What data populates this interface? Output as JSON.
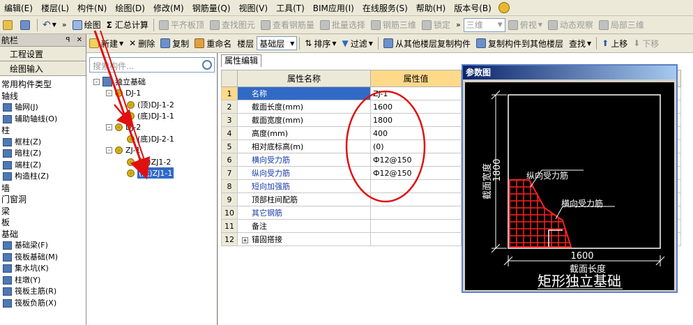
{
  "menubar": {
    "items": [
      "编辑(E)",
      "楼层(L)",
      "构件(N)",
      "绘图(D)",
      "修改(M)",
      "钢筋量(Q)",
      "视图(V)",
      "工具(T)",
      "BIM应用(I)",
      "在线服务(S)",
      "帮助(H)",
      "版本号(B)"
    ]
  },
  "toolbar1": {
    "draw": "绘图",
    "summary": "汇总计算",
    "flat_top": "平齐板顶",
    "find_element": "查找图元",
    "view_rebar": "查看钢筋量",
    "batch_select": "批量选择",
    "rebar_3d": "钢筋三维",
    "lock": "锁定",
    "view_mode": "三维",
    "top_view": "俯视",
    "dynamic_view": "动态观察",
    "local_3d": "局部三维"
  },
  "left_panel": {
    "title": "航栏",
    "btn_project": "工程设置",
    "btn_drawing": "绘图输入",
    "categories": [
      {
        "type": "cat",
        "label": "常用构件类型"
      },
      {
        "type": "cat",
        "label": "轴线"
      },
      {
        "type": "item",
        "label": "轴网(J)"
      },
      {
        "type": "item",
        "label": "辅助轴线(O)"
      },
      {
        "type": "cat",
        "label": "柱"
      },
      {
        "type": "item",
        "label": "框柱(Z)"
      },
      {
        "type": "item",
        "label": "暗柱(Z)"
      },
      {
        "type": "item",
        "label": "端柱(Z)"
      },
      {
        "type": "item",
        "label": "构造柱(Z)"
      },
      {
        "type": "cat",
        "label": "墙"
      },
      {
        "type": "cat",
        "label": "门窗洞"
      },
      {
        "type": "cat",
        "label": "梁"
      },
      {
        "type": "cat",
        "label": "板"
      },
      {
        "type": "cat",
        "label": "基础"
      },
      {
        "type": "item",
        "label": "基础梁(F)"
      },
      {
        "type": "item",
        "label": "筏板基础(M)"
      },
      {
        "type": "item",
        "label": "集水坑(K)"
      },
      {
        "type": "item",
        "label": "柱墩(Y)"
      },
      {
        "type": "item",
        "label": "筏板主筋(R)"
      },
      {
        "type": "item",
        "label": "筏板负筋(X)"
      }
    ]
  },
  "toolbar2": {
    "new": "新建",
    "delete": "删除",
    "copy": "复制",
    "rename": "重命名",
    "floor_label": "楼层",
    "floor_value": "基础层",
    "sort": "排序",
    "filter": "过滤",
    "copy_from": "从其他楼层复制构件",
    "copy_to": "复制构件到其他楼层",
    "find": "查找",
    "move_up": "上移",
    "move_down": "下移"
  },
  "tree": {
    "search_placeholder": "搜索构件...",
    "root": "独立基础",
    "nodes": [
      {
        "label": "DJ-1",
        "level": 1,
        "expand": "-"
      },
      {
        "label": "(顶)DJ-1-2",
        "level": 2
      },
      {
        "label": "(底)DJ-1-1",
        "level": 2
      },
      {
        "label": "DJ-2",
        "level": 1,
        "expand": "-"
      },
      {
        "label": "(底)DJ-2-1",
        "level": 2
      },
      {
        "label": "ZJ-1",
        "level": 1,
        "expand": "-"
      },
      {
        "label": "(顶)ZJ1-2",
        "level": 2
      },
      {
        "label": "(底)ZJ1-1",
        "level": 2,
        "selected": true
      }
    ]
  },
  "properties": {
    "tab": "属性编辑",
    "col_name": "属性名称",
    "col_value": "属性值",
    "rows": [
      {
        "num": "1",
        "name": "名称",
        "value": "ZJ-1",
        "blue": true
      },
      {
        "num": "2",
        "name": "截面长度(mm)",
        "value": "1600"
      },
      {
        "num": "3",
        "name": "截面宽度(mm)",
        "value": "1800"
      },
      {
        "num": "4",
        "name": "高度(mm)",
        "value": "400"
      },
      {
        "num": "5",
        "name": "相对底标高(m)",
        "value": "(0)"
      },
      {
        "num": "6",
        "name": "横向受力筋",
        "value": "Ф12@150",
        "blue": true
      },
      {
        "num": "7",
        "name": "纵向受力筋",
        "value": "Ф12@150",
        "blue": true
      },
      {
        "num": "8",
        "name": "短向加强筋",
        "value": "",
        "blue": true
      },
      {
        "num": "9",
        "name": "顶部柱间配筋",
        "value": ""
      },
      {
        "num": "10",
        "name": "其它钢筋",
        "value": "",
        "blue": true
      },
      {
        "num": "11",
        "name": "备注",
        "value": ""
      },
      {
        "num": "12",
        "name": "锚固搭接",
        "value": "",
        "plus": true
      }
    ]
  },
  "param_window": {
    "title": "参数图",
    "width_label": "截面宽度",
    "width_value": "1800",
    "length_label": "截面长度",
    "length_value": "1600",
    "long_rebar": "纵向受力筋",
    "trans_rebar": "横向受力筋",
    "caption": "矩形独立基础"
  },
  "colors": {
    "selection": "#316ac5",
    "value_header": "#ffd98a",
    "annotation_red": "#e01010"
  }
}
